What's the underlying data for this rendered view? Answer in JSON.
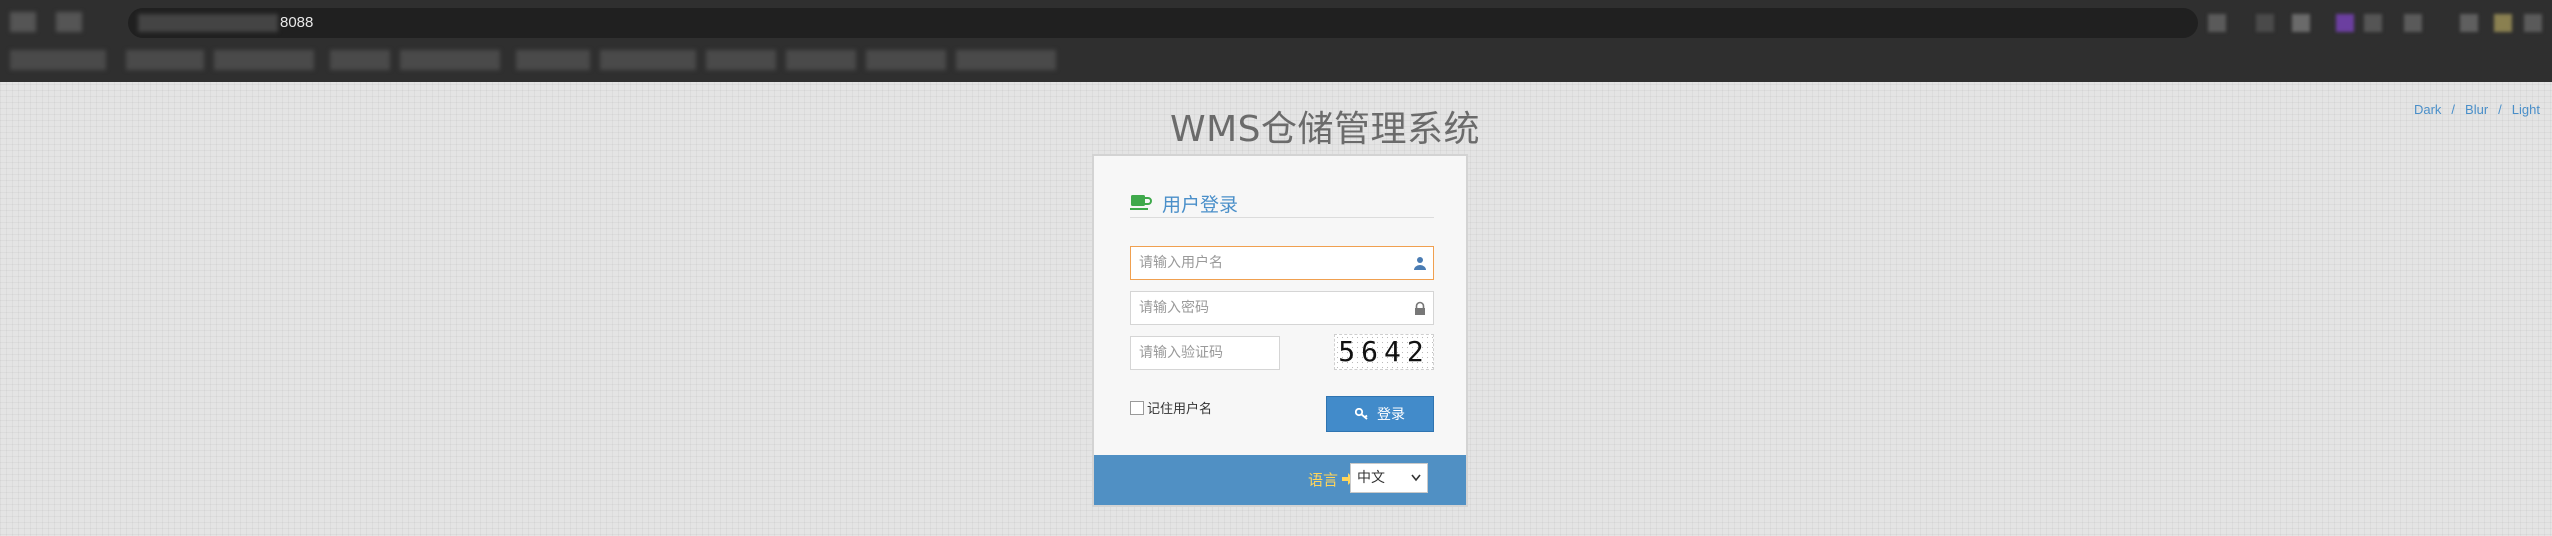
{
  "browser": {
    "address_text": "8088"
  },
  "theme_links": [
    "Dark",
    "Blur",
    "Light"
  ],
  "theme_separator": "/",
  "app_title": "WMS仓储管理系统",
  "login": {
    "title": "用户登录",
    "username_placeholder": "请输入用户名",
    "password_placeholder": "请输入密码",
    "captcha_placeholder": "请输入验证码",
    "captcha_code": "5642",
    "remember_label": "记住用户名",
    "submit_label": "登录"
  },
  "footer": {
    "language_label": "语言",
    "language_value": "中文"
  },
  "colors": {
    "accent": "#428bca",
    "title_blue": "#4a8fc9",
    "footer_bg": "#5090c4",
    "language_label": "#ffd55a",
    "focus_border": "#f0a050",
    "cup_icon": "#3fa94b"
  }
}
